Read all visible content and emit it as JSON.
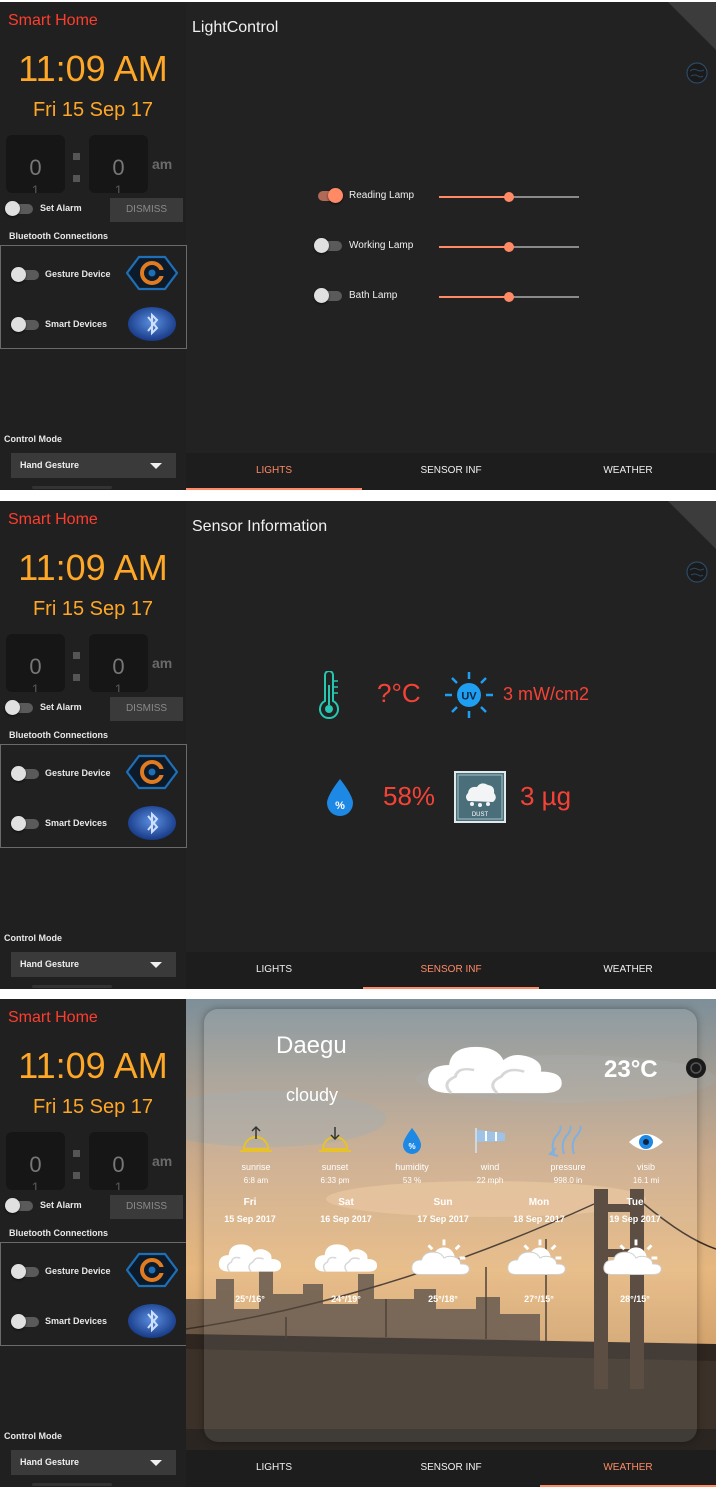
{
  "sidebar": {
    "app_title": "Smart Home",
    "time": "11:09 AM",
    "date": "Fri 15 Sep 17",
    "alarm_hour": "0",
    "alarm_hour_next": "1",
    "alarm_minute": "0",
    "alarm_minute_next": "1",
    "alarm_ampm": "am",
    "set_alarm_label": "Set Alarm",
    "set_alarm_on": false,
    "dismiss_label": "DISMISS",
    "bluetooth_title": "Bluetooth Connections",
    "gesture_device_label": "Gesture Device",
    "gesture_device_on": false,
    "smart_devices_label": "Smart Devices",
    "smart_devices_on": false,
    "control_mode_title": "Control Mode",
    "control_mode_value": "Hand Gesture"
  },
  "tabs": [
    {
      "label": "LIGHTS"
    },
    {
      "label": "SENSOR INF"
    },
    {
      "label": "WEATHER"
    }
  ],
  "lights_screen": {
    "title": "LightControl",
    "active_tab": "LIGHTS",
    "lamps": [
      {
        "label": "Reading Lamp",
        "on": true,
        "level": 0.5
      },
      {
        "label": "Working Lamp",
        "on": false,
        "level": 0.5
      },
      {
        "label": "Bath Lamp",
        "on": false,
        "level": 0.5
      }
    ]
  },
  "sensor_screen": {
    "title": "Sensor Information",
    "active_tab": "SENSOR INF",
    "temperature": "?°C",
    "uv": "3 mW/cm2",
    "uv_icon_text": "UV",
    "humidity": "58%",
    "humidity_icon_text": "%",
    "dust": "3 µg",
    "dust_icon_text": "DUST"
  },
  "weather_screen": {
    "active_tab": "WEATHER",
    "city": "Daegu",
    "condition": "cloudy",
    "temperature": "23°C",
    "stats": [
      {
        "label": "sunrise",
        "value": "6:8 am",
        "icon": "sunrise-icon"
      },
      {
        "label": "sunset",
        "value": "6:33 pm",
        "icon": "sunset-icon"
      },
      {
        "label": "humidity",
        "value": "53 %",
        "icon": "humidity-icon"
      },
      {
        "label": "wind",
        "value": "22 mph",
        "icon": "wind-icon"
      },
      {
        "label": "pressure",
        "value": "998.0 in",
        "icon": "pressure-icon"
      },
      {
        "label": "visib",
        "value": "16.1 mi",
        "icon": "visibility-icon"
      }
    ],
    "forecast": [
      {
        "day": "Fri",
        "date": "15 Sep 2017",
        "range": "25°/16°",
        "icon": "cloud-icon"
      },
      {
        "day": "Sat",
        "date": "16 Sep 2017",
        "range": "24°/19°",
        "icon": "cloud-icon"
      },
      {
        "day": "Sun",
        "date": "17 Sep 2017",
        "range": "25°/18°",
        "icon": "partly-cloudy-icon"
      },
      {
        "day": "Mon",
        "date": "18 Sep 2017",
        "range": "27°/15°",
        "icon": "partly-cloudy-icon"
      },
      {
        "day": "Tue",
        "date": "19 Sep 2017",
        "range": "28°/15°",
        "icon": "partly-cloudy-icon"
      }
    ]
  },
  "colors": {
    "accent": "#ff8a65",
    "title_red": "#ff3d2e",
    "clock_orange": "#ffa726",
    "sensor_red": "#f44336",
    "background": "#222222"
  }
}
